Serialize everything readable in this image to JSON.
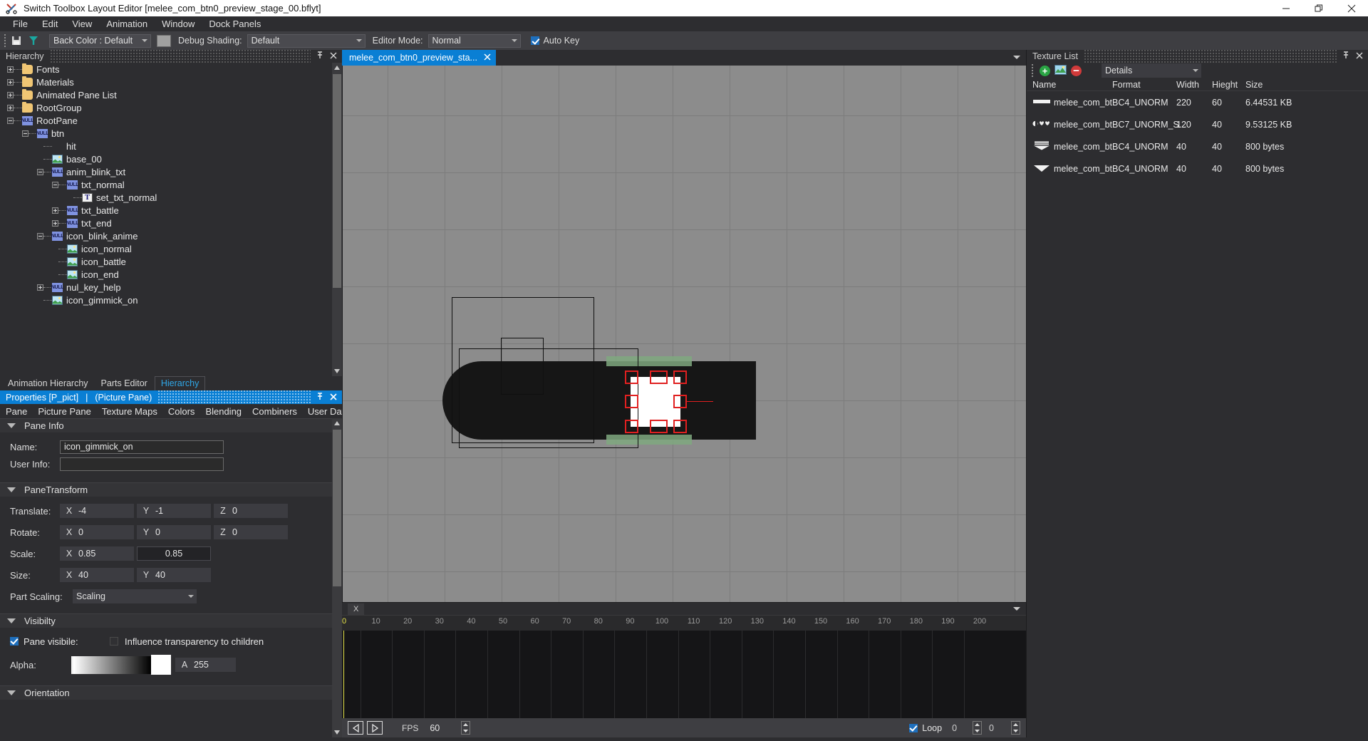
{
  "window": {
    "title": "Switch Toolbox Layout Editor [melee_com_btn0_preview_stage_00.bflyt]",
    "app_icon": "scissors-icon",
    "minimize": "minimize-icon",
    "maximize": "restore-icon",
    "close": "close-icon"
  },
  "menu": {
    "items": [
      "File",
      "Edit",
      "View",
      "Animation",
      "Window",
      "Dock Panels"
    ]
  },
  "toolbar": {
    "back_color_label": "Back Color : Default",
    "back_color_swatch": "#a0a0a0",
    "debug_shading_label": "Debug Shading:",
    "debug_shading_value": "Default",
    "editor_mode_label": "Editor Mode:",
    "editor_mode_value": "Normal",
    "auto_key_label": "Auto Key",
    "auto_key_checked": true
  },
  "hierarchy": {
    "title": "Hierarchy",
    "pin": "pin-icon",
    "close": "close-icon",
    "nodes": [
      {
        "label": "Fonts",
        "icon": "folder",
        "depth": 0,
        "expander": "plus"
      },
      {
        "label": "Materials",
        "icon": "folder",
        "depth": 0,
        "expander": "plus"
      },
      {
        "label": "Animated Pane List",
        "icon": "folder",
        "depth": 0,
        "expander": "plus"
      },
      {
        "label": "RootGroup",
        "icon": "folder",
        "depth": 0,
        "expander": "plus"
      },
      {
        "label": "RootPane",
        "icon": "null",
        "depth": 0,
        "expander": "minus"
      },
      {
        "label": "btn",
        "icon": "null",
        "depth": 1,
        "expander": "minus"
      },
      {
        "label": "hit",
        "icon": "none",
        "depth": 2,
        "expander": "none"
      },
      {
        "label": "base_00",
        "icon": "pic",
        "depth": 2,
        "expander": "none"
      },
      {
        "label": "anim_blink_txt",
        "icon": "null",
        "depth": 2,
        "expander": "minus"
      },
      {
        "label": "txt_normal",
        "icon": "null",
        "depth": 3,
        "expander": "minus"
      },
      {
        "label": "set_txt_normal",
        "icon": "txt",
        "depth": 4,
        "expander": "none"
      },
      {
        "label": "txt_battle",
        "icon": "null",
        "depth": 3,
        "expander": "plus"
      },
      {
        "label": "txt_end",
        "icon": "null",
        "depth": 3,
        "expander": "plus"
      },
      {
        "label": "icon_blink_anime",
        "icon": "null",
        "depth": 2,
        "expander": "minus"
      },
      {
        "label": "icon_normal",
        "icon": "pic",
        "depth": 3,
        "expander": "none"
      },
      {
        "label": "icon_battle",
        "icon": "pic",
        "depth": 3,
        "expander": "none"
      },
      {
        "label": "icon_end",
        "icon": "pic",
        "depth": 3,
        "expander": "none"
      },
      {
        "label": "nul_key_help",
        "icon": "null",
        "depth": 2,
        "expander": "plus"
      },
      {
        "label": "icon_gimmick_on",
        "icon": "pic",
        "depth": 2,
        "expander": "none"
      }
    ],
    "bottom_tabs": [
      {
        "label": "Animation Hierarchy",
        "selected": false
      },
      {
        "label": "Parts Editor",
        "selected": false
      },
      {
        "label": "Hierarchy",
        "selected": true
      }
    ]
  },
  "properties": {
    "title": "Properties [P_pict]",
    "separator": "|",
    "subtitle": "(Picture Pane)",
    "pin": "pin-icon",
    "close": "close-icon",
    "tabs": [
      "Pane",
      "Picture Pane",
      "Texture Maps",
      "Colors",
      "Blending",
      "Combiners",
      "User Data"
    ],
    "pane_info": {
      "header": "Pane Info",
      "name_label": "Name:",
      "name_value": "icon_gimmick_on",
      "user_info_label": "User Info:",
      "user_info_value": ""
    },
    "pane_transform": {
      "header": "PaneTransform",
      "translate_label": "Translate:",
      "translate": {
        "x_axis": "X",
        "x": "-4",
        "y_axis": "Y",
        "y": "-1",
        "z_axis": "Z",
        "z": "0"
      },
      "rotate_label": "Rotate:",
      "rotate": {
        "x_axis": "X",
        "x": "0",
        "y_axis": "Y",
        "y": "0",
        "z_axis": "Z",
        "z": "0"
      },
      "scale_label": "Scale:",
      "scale": {
        "x_axis": "X",
        "x": "0.85",
        "y": "0.85"
      },
      "size_label": "Size:",
      "size": {
        "x_axis": "X",
        "x": "40",
        "y_axis": "Y",
        "y": "40"
      },
      "part_scaling_label": "Part Scaling:",
      "part_scaling_value": "Scaling"
    },
    "visibility": {
      "header": "Visibilty",
      "pane_visible_label": "Pane visibile:",
      "pane_visible_checked": true,
      "influence_label": "Influence transparency to children",
      "influence_checked": false,
      "alpha_label": "Alpha:",
      "alpha_axis": "A",
      "alpha_value": "255"
    },
    "orientation": {
      "header": "Orientation"
    }
  },
  "document": {
    "tab_label": "melee_com_btn0_preview_sta...",
    "tab_close": "close-icon",
    "tab_menu": "chevron-down-icon"
  },
  "timeline": {
    "tab_label": "X",
    "menu": "chevron-down-icon",
    "ticks": [
      "0",
      "10",
      "20",
      "30",
      "40",
      "50",
      "60",
      "70",
      "80",
      "90",
      "100",
      "110",
      "120",
      "130",
      "140",
      "150",
      "160",
      "170",
      "180",
      "190",
      "200"
    ],
    "playhead_frame": "0",
    "prev_button": "play-left-icon",
    "next_button": "play-right-icon",
    "fps_label": "FPS",
    "fps_value": "60",
    "fps_stepper": "stepper-icon",
    "loop_label": "Loop",
    "loop_checked": true,
    "loop_value": "0",
    "start_stepper": "stepper-icon",
    "end_value": "0",
    "end_stepper": "stepper-icon"
  },
  "texture_list": {
    "title": "Texture List",
    "pin": "pin-icon",
    "close": "close-icon",
    "add_button": "plus-circle-icon",
    "image_button": "image-icon",
    "remove_button": "minus-circle-icon",
    "view_mode": "Details",
    "columns": [
      "Name",
      "Format",
      "Width",
      "Hieght",
      "Size"
    ],
    "rows": [
      {
        "name": "melee_com_bt...",
        "format": "BC4_UNORM",
        "width": "220",
        "height": "60",
        "size": "6.44531 KB",
        "thumb": "bar-thumb"
      },
      {
        "name": "melee_com_bt...",
        "format": "BC7_UNORM_S...",
        "width": "120",
        "height": "40",
        "size": "9.53125 KB",
        "thumb": "glyphs-thumb"
      },
      {
        "name": "melee_com_bt...",
        "format": "BC4_UNORM",
        "width": "40",
        "height": "40",
        "size": "800 bytes",
        "thumb": "tri-lines-thumb"
      },
      {
        "name": "melee_com_bt...",
        "format": "BC4_UNORM",
        "width": "40",
        "height": "40",
        "size": "800 bytes",
        "thumb": "tri-thumb"
      }
    ]
  },
  "colors": {
    "accent": "#0a7fd4",
    "panel_bg": "#2d2d30",
    "toolbar_bg": "#3e3e42",
    "canvas_bg": "#8c8c8c",
    "selection_red": "#e02020",
    "playhead_yellow": "#e3e14a"
  }
}
